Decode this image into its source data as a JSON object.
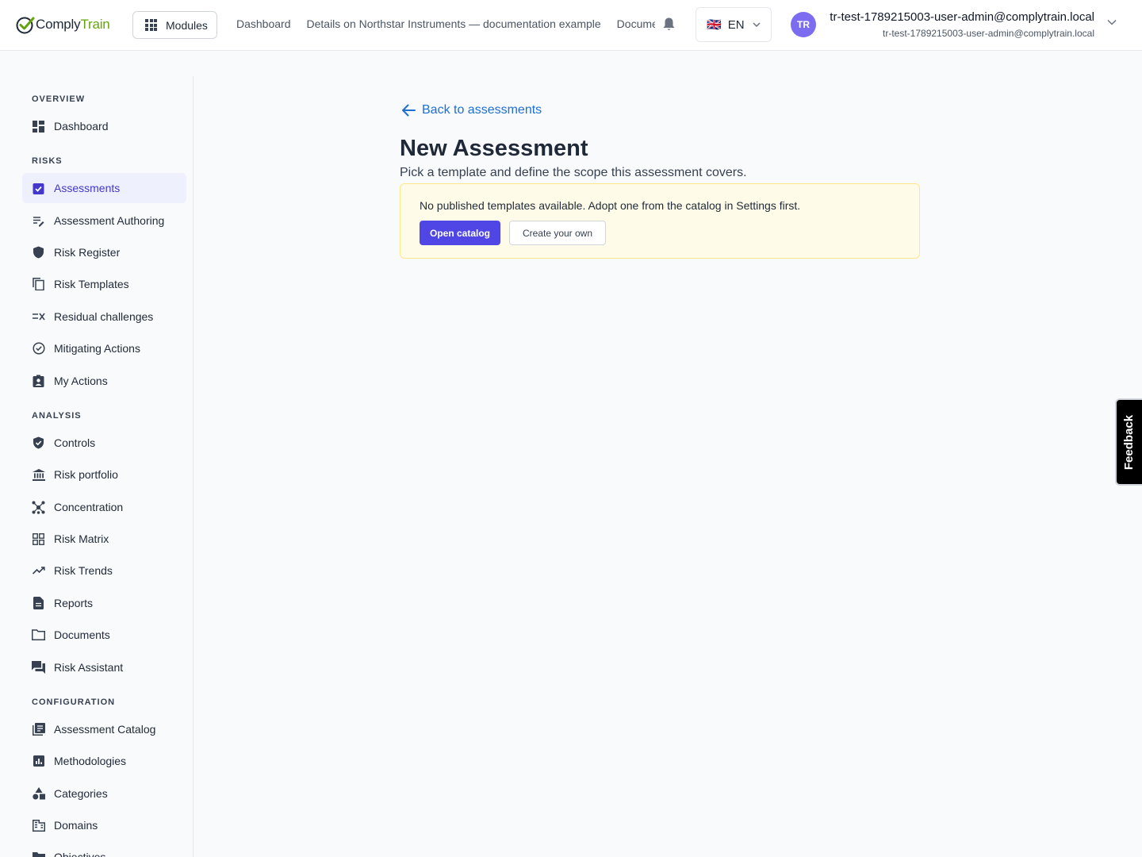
{
  "brand": {
    "name_part1": "Comply",
    "name_part2": "Train"
  },
  "topbar": {
    "modules_label": "Modules",
    "nav_links": [
      "Dashboard",
      "Details on Northstar Instruments — documentation example",
      "Documents"
    ],
    "language": {
      "flag": "🇬🇧",
      "code": "EN"
    },
    "user": {
      "initials": "TR",
      "name": "tr-test-1789215003-user-admin@complytrain.local",
      "email": "tr-test-1789215003-user-admin@complytrain.local"
    }
  },
  "sidebar": {
    "sections": [
      {
        "label": "OVERVIEW",
        "items": [
          {
            "label": "Dashboard",
            "icon": "dashboard-icon"
          }
        ]
      },
      {
        "label": "RISKS",
        "items": [
          {
            "label": "Assessments",
            "icon": "clipboard-check-icon",
            "active": true
          },
          {
            "label": "Assessment Authoring",
            "icon": "edit-list-icon"
          },
          {
            "label": "Risk Register",
            "icon": "shield-icon"
          },
          {
            "label": "Risk Templates",
            "icon": "copy-icon"
          },
          {
            "label": "Residual challenges",
            "icon": "rule-icon"
          },
          {
            "label": "Mitigating Actions",
            "icon": "check-circle-icon"
          },
          {
            "label": "My Actions",
            "icon": "assignment-ind-icon"
          }
        ]
      },
      {
        "label": "ANALYSIS",
        "items": [
          {
            "label": "Controls",
            "icon": "shield-check-icon"
          },
          {
            "label": "Risk portfolio",
            "icon": "bank-icon"
          },
          {
            "label": "Concentration",
            "icon": "hub-icon"
          },
          {
            "label": "Risk Matrix",
            "icon": "grid-icon"
          },
          {
            "label": "Risk Trends",
            "icon": "trend-icon"
          },
          {
            "label": "Reports",
            "icon": "report-icon"
          },
          {
            "label": "Documents",
            "icon": "folder-icon"
          },
          {
            "label": "Risk Assistant",
            "icon": "chat-icon"
          }
        ]
      },
      {
        "label": "CONFIGURATION",
        "items": [
          {
            "label": "Assessment Catalog",
            "icon": "catalog-icon"
          },
          {
            "label": "Methodologies",
            "icon": "chart-box-icon"
          },
          {
            "label": "Categories",
            "icon": "shapes-icon"
          },
          {
            "label": "Domains",
            "icon": "building-icon"
          },
          {
            "label": "Objectives",
            "icon": "folder-fill-icon"
          }
        ]
      }
    ]
  },
  "main": {
    "back_label": "Back to assessments",
    "title": "New Assessment",
    "subtitle": "Pick a template and define the scope this assessment covers.",
    "notice": {
      "text": "No published templates available. Adopt one from the catalog in Settings first.",
      "primary_label": "Open catalog",
      "secondary_label": "Create your own"
    }
  },
  "feedback_label": "Feedback",
  "colors": {
    "accent": "#4f46e5",
    "link": "#1d6fd6",
    "notice_bg": "#fefce8",
    "notice_border": "#fde68a",
    "brand_green": "#65a30d"
  }
}
